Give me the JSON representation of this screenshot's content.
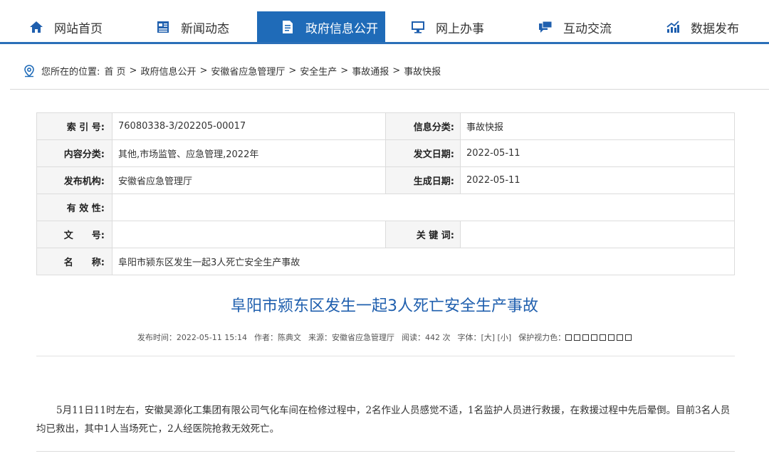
{
  "nav": {
    "items": [
      {
        "label": "网站首页",
        "icon": "home-icon"
      },
      {
        "label": "新闻动态",
        "icon": "news-icon"
      },
      {
        "label": "政府信息公开",
        "icon": "document-icon"
      },
      {
        "label": "网上办事",
        "icon": "monitor-icon"
      },
      {
        "label": "互动交流",
        "icon": "chat-icon"
      },
      {
        "label": "数据发布",
        "icon": "chart-icon"
      }
    ],
    "active_index": 2,
    "accent_color": "#1f6bb8"
  },
  "breadcrumb": {
    "prefix": "您所在的位置:",
    "items": [
      "首 页",
      "政府信息公开",
      "安徽省应急管理厅",
      "安全生产",
      "事故通报",
      "事故快报"
    ],
    "separator": ">"
  },
  "meta": {
    "index_label": "索 引 号:",
    "index_value": "76080338-3/202205-00017",
    "category_label": "信息分类:",
    "category_value": "事故快报",
    "content_label": "内容分类:",
    "content_value": "其他,市场监管、应急管理,2022年",
    "issue_date_label": "发文日期:",
    "issue_date_value": "2022-05-11",
    "publisher_label": "发布机构:",
    "publisher_value": "安徽省应急管理厅",
    "gen_date_label": "生成日期:",
    "gen_date_value": "2022-05-11",
    "validity_label": "有 效 性:",
    "validity_value": "",
    "docno_label": "文　　号:",
    "docno_value": "",
    "keywords_label": "关 键 词:",
    "keywords_value": "",
    "name_label": "名　　称:",
    "name_value": "阜阳市颍东区发生一起3人死亡安全生产事故"
  },
  "article": {
    "title": "阜阳市颍东区发生一起3人死亡安全生产事故",
    "publish_time": "发布时间：2022-05-11 15:14",
    "author": "作者：陈典文",
    "source": "来源：安徽省应急管理厅",
    "reads": "阅读：442 次",
    "font_size": "字体：[大] [小]",
    "eye_color": "保护视力色：",
    "body": "5月11日11时左右，安徽昊源化工集团有限公司气化车间在检修过程中，2名作业人员感觉不适，1名监护人员进行救援，在救援过程中先后晕倒。目前3名人员均已救出，其中1人当场死亡，2人经医院抢救无效死亡。"
  }
}
